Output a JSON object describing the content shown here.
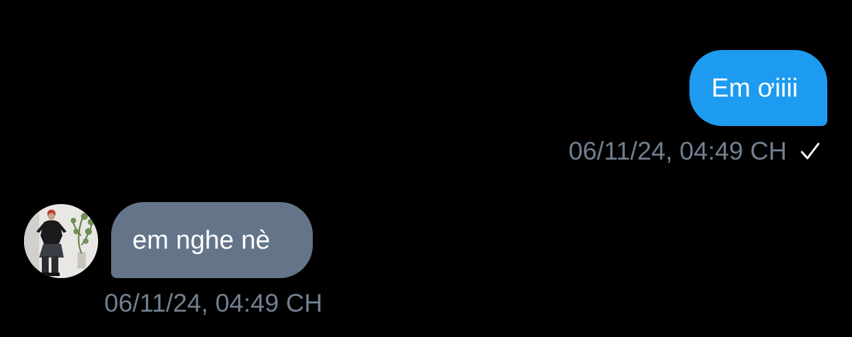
{
  "messages": [
    {
      "direction": "outgoing",
      "text": "Em ơiiii",
      "timestamp": "06/11/24, 04:49 CH",
      "status_icon": "check-icon"
    },
    {
      "direction": "incoming",
      "text": "em nghe nè",
      "timestamp": "06/11/24, 04:49 CH",
      "avatar_icon": "avatar"
    }
  ],
  "colors": {
    "background": "#000000",
    "outgoing_bubble": "#1d9bf0",
    "incoming_bubble": "#64758a",
    "timestamp": "#71808f",
    "message_text": "#ffffff"
  }
}
